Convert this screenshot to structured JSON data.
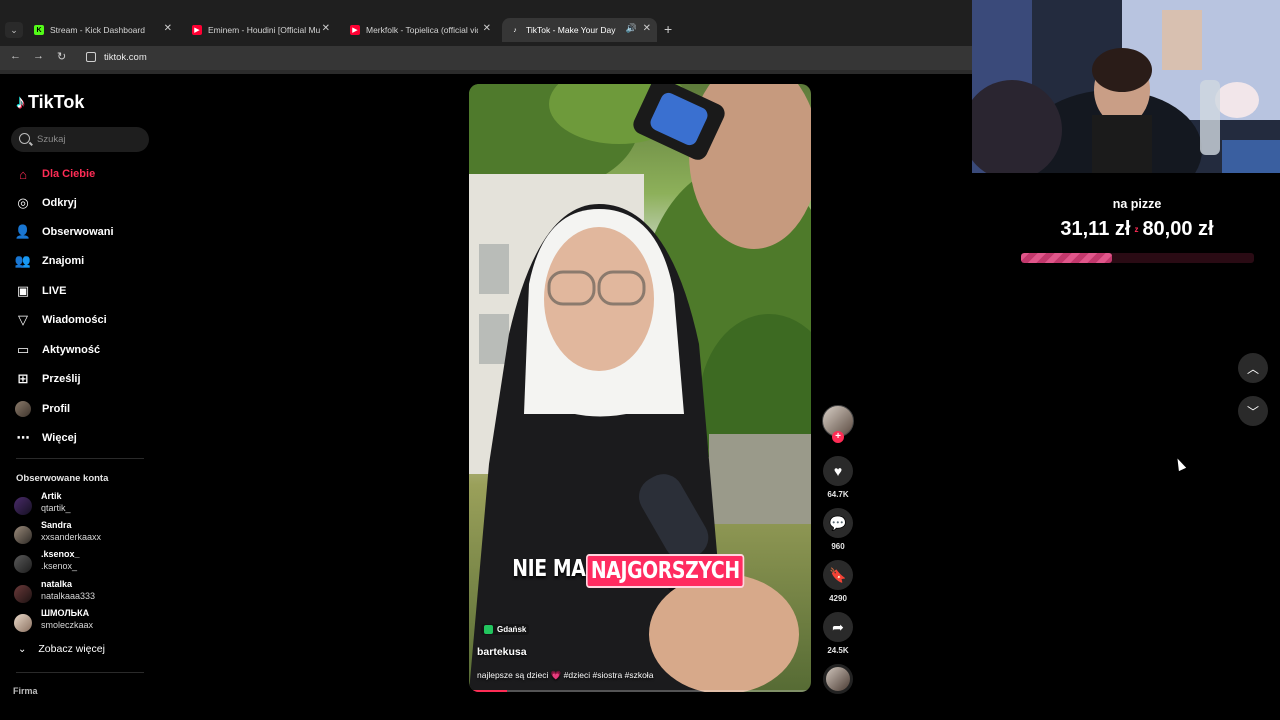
{
  "browser": {
    "tabs": [
      {
        "label": "Stream - Kick Dashboard",
        "favicon": "kick-icon",
        "active": false
      },
      {
        "label": "Eminem - Houdini [Official Mus",
        "favicon": "youtube-icon",
        "active": false
      },
      {
        "label": "Merkfolk - Topielica (official vid",
        "favicon": "youtube-icon",
        "active": false
      },
      {
        "label": "TikTok - Make Your Day",
        "favicon": "tiktok-icon",
        "active": true
      }
    ],
    "url": "tiktok.com"
  },
  "sidebar": {
    "logo": "TikTok",
    "search_placeholder": "Szukaj",
    "nav": [
      {
        "label": "Dla Ciebie",
        "icon": "home-icon",
        "active": true
      },
      {
        "label": "Odkryj",
        "icon": "compass-icon"
      },
      {
        "label": "Obserwowani",
        "icon": "following-icon"
      },
      {
        "label": "Znajomi",
        "icon": "friends-icon"
      },
      {
        "label": "LIVE",
        "icon": "live-icon"
      },
      {
        "label": "Wiadomości",
        "icon": "messages-icon"
      },
      {
        "label": "Aktywność",
        "icon": "activity-icon"
      },
      {
        "label": "Prześlij",
        "icon": "upload-icon"
      },
      {
        "label": "Profil",
        "icon": "profile-avatar"
      },
      {
        "label": "Więcej",
        "icon": "more-icon"
      }
    ],
    "following_header": "Obserwowane konta",
    "accounts": [
      {
        "name": "Artik",
        "handle": "qtartik_"
      },
      {
        "name": "Sandra",
        "handle": "xxsanderkaaxx"
      },
      {
        "name": ".ksenox_",
        "handle": ".ksenox_"
      },
      {
        "name": "natalka",
        "handle": "natalkaaa333"
      },
      {
        "name": "ШМОЛЬКА",
        "handle": "smoleczkaax"
      }
    ],
    "see_more": "Zobacz więcej",
    "footer": "Firma"
  },
  "video": {
    "caption_plain": "NIE MA",
    "caption_highlight": "NAJGORSZYCH",
    "location": "Gdańsk",
    "author": "bartekusa",
    "description": "najlepsze są dzieci 💗 #dzieci #siostra #szkoła",
    "progress": 0.11
  },
  "actions": {
    "likes": "64.7K",
    "comments": "960",
    "saves": "4290",
    "shares": "24.5K"
  },
  "overlay": {
    "goal_title": "na pizze",
    "goal_current": "31,11 zł",
    "goal_separator": "z",
    "goal_target": "80,00 zł",
    "goal_progress": 0.389,
    "accent": "#fe2c55"
  }
}
